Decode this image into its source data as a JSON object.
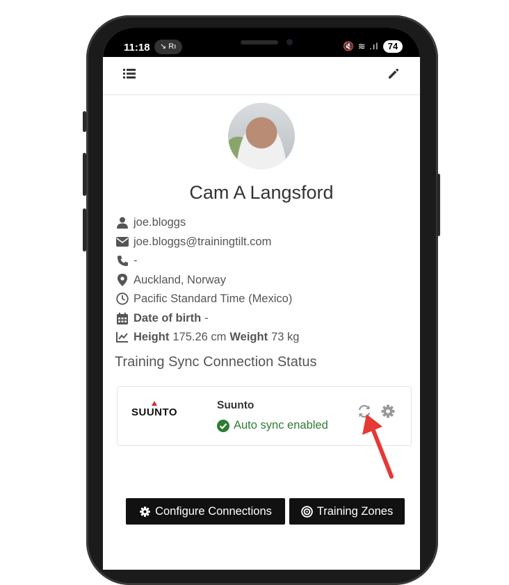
{
  "status_bar": {
    "time": "11:18",
    "pill_text": "↘ Rı",
    "icons": "🔇 ≋ .ıl",
    "battery": "74"
  },
  "profile": {
    "name": "Cam A Langsford",
    "username": "joe.bloggs",
    "email": "joe.bloggs@trainingtilt.com",
    "phone": "-",
    "location": "Auckland, Norway",
    "timezone": "Pacific Standard Time (Mexico)",
    "dob_label": "Date of birth",
    "dob_value": "-",
    "height_label": "Height",
    "height_value": "175.26 cm",
    "weight_label": "Weight",
    "weight_value": "73 kg"
  },
  "sync": {
    "section_title": "Training Sync Connection Status",
    "provider_logo": "SUUNTO",
    "provider_name": "Suunto",
    "status": "Auto sync enabled"
  },
  "buttons": {
    "configure": "Configure Connections",
    "zones": "Training Zones"
  },
  "colors": {
    "accent_dark": "#111111",
    "success": "#2e7d32",
    "annotation_arrow": "#e53935"
  }
}
